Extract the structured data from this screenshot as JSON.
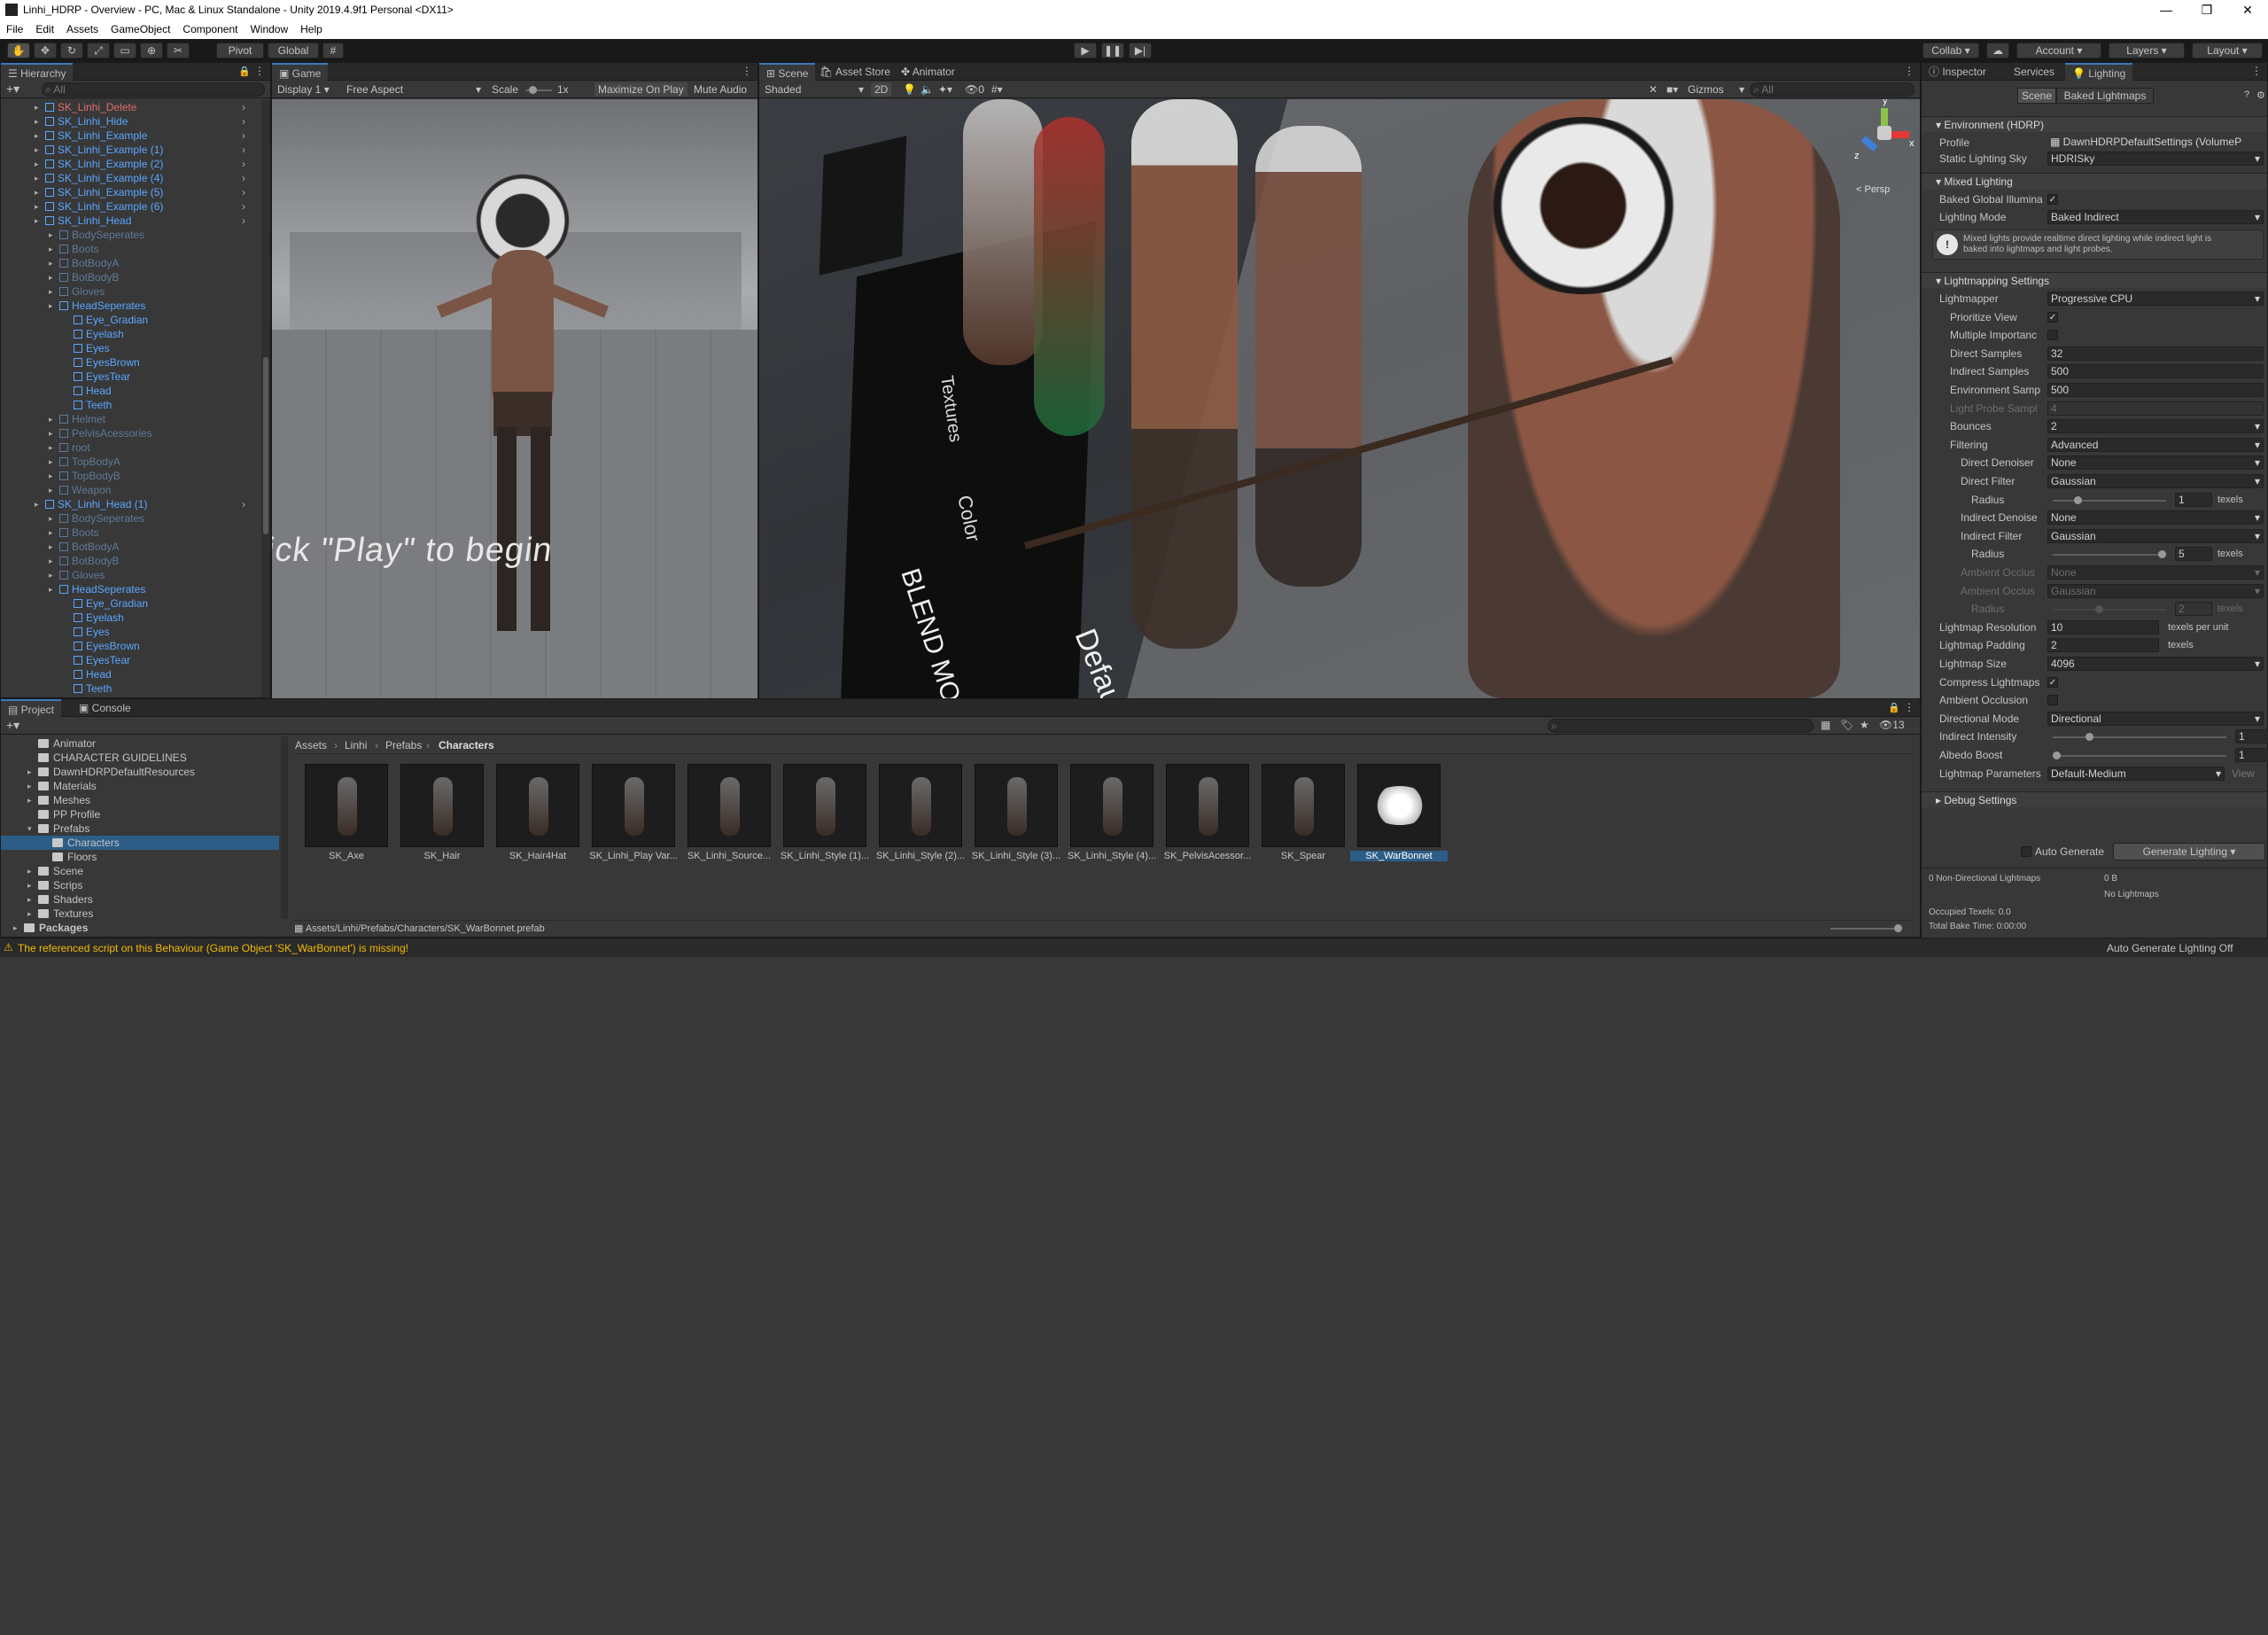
{
  "window": {
    "title": "Linhi_HDRP - Overview - PC, Mac & Linux Standalone - Unity 2019.4.9f1 Personal <DX11>"
  },
  "menu": [
    "File",
    "Edit",
    "Assets",
    "GameObject",
    "Component",
    "Window",
    "Help"
  ],
  "toolbar": {
    "pivot": "Pivot",
    "global": "Global",
    "collab": "Collab",
    "account": "Account",
    "layers": "Layers",
    "layout": "Layout"
  },
  "hierarchy": {
    "tab": "Hierarchy",
    "search_placeholder": "All",
    "items": [
      {
        "label": "SK_Linhi_Delete",
        "indent": 0,
        "style": "red"
      },
      {
        "label": "SK_Linhi_Hide",
        "indent": 0,
        "style": "blue"
      },
      {
        "label": "SK_Linhi_Example",
        "indent": 0,
        "style": "blue"
      },
      {
        "label": "SK_Linhi_Example (1)",
        "indent": 0,
        "style": "blue"
      },
      {
        "label": "SK_Linhi_Example (2)",
        "indent": 0,
        "style": "blue"
      },
      {
        "label": "SK_Linhi_Example (4)",
        "indent": 0,
        "style": "blue"
      },
      {
        "label": "SK_Linhi_Example (5)",
        "indent": 0,
        "style": "blue"
      },
      {
        "label": "SK_Linhi_Example (6)",
        "indent": 0,
        "style": "blue"
      },
      {
        "label": "SK_Linhi_Head",
        "indent": 0,
        "style": "blue"
      },
      {
        "label": "BodySeperates",
        "indent": 1,
        "style": "dim"
      },
      {
        "label": "Boots",
        "indent": 1,
        "style": "dim"
      },
      {
        "label": "BotBodyA",
        "indent": 1,
        "style": "dim"
      },
      {
        "label": "BotBodyB",
        "indent": 1,
        "style": "dim"
      },
      {
        "label": "Gloves",
        "indent": 1,
        "style": "dim"
      },
      {
        "label": "HeadSeperates",
        "indent": 1,
        "style": "blue"
      },
      {
        "label": "Eye_Gradian",
        "indent": 2,
        "style": "blue"
      },
      {
        "label": "Eyelash",
        "indent": 2,
        "style": "blue"
      },
      {
        "label": "Eyes",
        "indent": 2,
        "style": "blue"
      },
      {
        "label": "EyesBrown",
        "indent": 2,
        "style": "blue"
      },
      {
        "label": "EyesTear",
        "indent": 2,
        "style": "blue"
      },
      {
        "label": "Head",
        "indent": 2,
        "style": "blue"
      },
      {
        "label": "Teeth",
        "indent": 2,
        "style": "blue"
      },
      {
        "label": "Helmet",
        "indent": 1,
        "style": "dim"
      },
      {
        "label": "PelvisAcessories",
        "indent": 1,
        "style": "dim"
      },
      {
        "label": "root",
        "indent": 1,
        "style": "dim"
      },
      {
        "label": "TopBodyA",
        "indent": 1,
        "style": "dim"
      },
      {
        "label": "TopBodyB",
        "indent": 1,
        "style": "dim"
      },
      {
        "label": "Weapon",
        "indent": 1,
        "style": "dim"
      },
      {
        "label": "SK_Linhi_Head (1)",
        "indent": 0,
        "style": "blue"
      },
      {
        "label": "BodySeperates",
        "indent": 1,
        "style": "dim"
      },
      {
        "label": "Boots",
        "indent": 1,
        "style": "dim"
      },
      {
        "label": "BotBodyA",
        "indent": 1,
        "style": "dim"
      },
      {
        "label": "BotBodyB",
        "indent": 1,
        "style": "dim"
      },
      {
        "label": "Gloves",
        "indent": 1,
        "style": "dim"
      },
      {
        "label": "HeadSeperates",
        "indent": 1,
        "style": "blue"
      },
      {
        "label": "Eye_Gradian",
        "indent": 2,
        "style": "blue"
      },
      {
        "label": "Eyelash",
        "indent": 2,
        "style": "blue"
      },
      {
        "label": "Eyes",
        "indent": 2,
        "style": "blue"
      },
      {
        "label": "EyesBrown",
        "indent": 2,
        "style": "blue"
      },
      {
        "label": "EyesTear",
        "indent": 2,
        "style": "blue"
      },
      {
        "label": "Head",
        "indent": 2,
        "style": "blue"
      },
      {
        "label": "Teeth",
        "indent": 2,
        "style": "blue"
      }
    ]
  },
  "game": {
    "tab": "Game",
    "display": "Display 1",
    "aspect": "Free Aspect",
    "scale_label": "Scale",
    "scale_value": "1x",
    "maximize": "Maximize On Play",
    "mute": "Mute Audio",
    "overlay": "ick \"Play\" to begin"
  },
  "scene": {
    "tabs": [
      "Scene",
      "Asset Store",
      "Animator"
    ],
    "shading": "Shaded",
    "mode2d": "2D",
    "gizmos": "Gizmos",
    "search_placeholder": "All",
    "persp": "< Persp",
    "sign_texts": [
      "Textures",
      "Color",
      "BLEND MODE",
      "Default"
    ],
    "axes": [
      "y",
      "x",
      "z"
    ]
  },
  "inspector": {
    "tabs": [
      "Inspector",
      "Services",
      "Lighting"
    ],
    "subtabs": [
      "Scene",
      "Baked Lightmaps"
    ],
    "env_header": "Environment (HDRP)",
    "profile_label": "Profile",
    "profile_value": "DawnHDRPDefaultSettings (VolumeP",
    "sky_label": "Static Lighting Sky",
    "sky_value": "HDRISky",
    "mixed_header": "Mixed Lighting",
    "baked_gi_label": "Baked Global Illumina",
    "lighting_mode_label": "Lighting Mode",
    "lighting_mode_value": "Baked Indirect",
    "info_text_1": "Mixed lights provide realtime direct lighting while indirect light is",
    "info_text_2": "baked into lightmaps and light probes.",
    "lm_header": "Lightmapping Settings",
    "rows": [
      {
        "label": "Lightmapper",
        "value": "Progressive CPU",
        "type": "drop"
      },
      {
        "label": "Prioritize View",
        "value": "✓",
        "type": "check",
        "indent": 1
      },
      {
        "label": "Multiple Importanc",
        "value": "",
        "type": "check",
        "indent": 1
      },
      {
        "label": "Direct Samples",
        "value": "32",
        "type": "field",
        "indent": 1
      },
      {
        "label": "Indirect Samples",
        "value": "500",
        "type": "field",
        "indent": 1
      },
      {
        "label": "Environment Samp",
        "value": "500",
        "type": "field",
        "indent": 1
      },
      {
        "label": "Light Probe Sampl",
        "value": "4",
        "type": "field",
        "indent": 1,
        "dis": true
      },
      {
        "label": "Bounces",
        "value": "2",
        "type": "drop",
        "indent": 1
      },
      {
        "label": "Filtering",
        "value": "Advanced",
        "type": "drop",
        "indent": 1
      },
      {
        "label": "Direct Denoiser",
        "value": "None",
        "type": "drop",
        "indent": 2
      },
      {
        "label": "Direct Filter",
        "value": "Gaussian",
        "type": "drop",
        "indent": 2
      },
      {
        "label": "Radius",
        "value": "1",
        "type": "slider",
        "indent": 3,
        "unit": "texels",
        "pos": 0.2
      },
      {
        "label": "Indirect Denoise",
        "value": "None",
        "type": "drop",
        "indent": 2
      },
      {
        "label": "Indirect Filter",
        "value": "Gaussian",
        "type": "drop",
        "indent": 2
      },
      {
        "label": "Radius",
        "value": "5",
        "type": "slider",
        "indent": 3,
        "unit": "texels",
        "pos": 1.0
      },
      {
        "label": "Ambient Occlus",
        "value": "None",
        "type": "drop",
        "indent": 2,
        "dis": true
      },
      {
        "label": "Ambient Occlus",
        "value": "Gaussian",
        "type": "drop",
        "indent": 2,
        "dis": true
      },
      {
        "label": "Radius",
        "value": "2",
        "type": "slider",
        "indent": 3,
        "unit": "texels",
        "pos": 0.4,
        "dis": true
      },
      {
        "label": "Lightmap Resolution",
        "value": "10",
        "type": "field",
        "unit": "texels per unit"
      },
      {
        "label": "Lightmap Padding",
        "value": "2",
        "type": "field",
        "unit": "texels"
      },
      {
        "label": "Lightmap Size",
        "value": "4096",
        "type": "drop"
      },
      {
        "label": "Compress Lightmaps",
        "value": "✓",
        "type": "check"
      },
      {
        "label": "Ambient Occlusion",
        "value": "",
        "type": "check"
      },
      {
        "label": "Directional Mode",
        "value": "Directional",
        "type": "drop"
      },
      {
        "label": "Indirect Intensity",
        "value": "1",
        "type": "slider",
        "pos": 0.2
      },
      {
        "label": "Albedo Boost",
        "value": "1",
        "type": "slider",
        "pos": 0.0
      },
      {
        "label": "Lightmap Parameters",
        "value": "Default-Medium",
        "type": "drop",
        "view": "View"
      }
    ],
    "debug_header": "Debug Settings",
    "auto_generate": "Auto Generate",
    "generate": "Generate Lighting",
    "stats": {
      "nondir": "0 Non-Directional Lightmaps",
      "size": "0 B",
      "nolm": "No Lightmaps",
      "occupied": "Occupied Texels: 0.0",
      "bake": "Total Bake Time: 0:00:00"
    }
  },
  "project": {
    "tabs": [
      "Project",
      "Console"
    ],
    "breadcrumb": [
      "Assets",
      "Linhi",
      "Prefabs",
      "Characters"
    ],
    "count": "13",
    "tree": [
      {
        "label": "Animator",
        "indent": 1,
        "arrow": false
      },
      {
        "label": "CHARACTER GUIDELINES",
        "indent": 1,
        "arrow": false
      },
      {
        "label": "DawnHDRPDefaultResources",
        "indent": 1,
        "arrow": true
      },
      {
        "label": "Materials",
        "indent": 1,
        "arrow": true
      },
      {
        "label": "Meshes",
        "indent": 1,
        "arrow": true
      },
      {
        "label": "PP Profile",
        "indent": 1,
        "arrow": false
      },
      {
        "label": "Prefabs",
        "indent": 1,
        "arrow": true,
        "open": true
      },
      {
        "label": "Characters",
        "indent": 2,
        "arrow": false,
        "sel": true
      },
      {
        "label": "Floors",
        "indent": 2,
        "arrow": false
      },
      {
        "label": "Scene",
        "indent": 1,
        "arrow": true
      },
      {
        "label": "Scrips",
        "indent": 1,
        "arrow": true
      },
      {
        "label": "Shaders",
        "indent": 1,
        "arrow": true
      },
      {
        "label": "Textures",
        "indent": 1,
        "arrow": true
      },
      {
        "label": "Packages",
        "indent": 0,
        "arrow": true
      }
    ],
    "assets": [
      "SK_Axe",
      "SK_Hair",
      "SK_Hair4Hat",
      "SK_Linhi_Play Var...",
      "SK_Linhi_Source...",
      "SK_Linhi_Style (1)...",
      "SK_Linhi_Style (2)...",
      "SK_Linhi_Style (3)...",
      "SK_Linhi_Style (4)...",
      "SK_PelvisAcessor...",
      "SK_Spear",
      "SK_WarBonnet"
    ],
    "path": "Assets/Linhi/Prefabs/Characters/SK_WarBonnet.prefab"
  },
  "status": {
    "warning": "The referenced script on this Behaviour (Game Object 'SK_WarBonnet') is missing!",
    "right": "Auto Generate Lighting Off"
  },
  "colors": {
    "accent": "#3a79bb",
    "prefab_blue": "#5aa6ff",
    "warning": "#f4bc02"
  }
}
